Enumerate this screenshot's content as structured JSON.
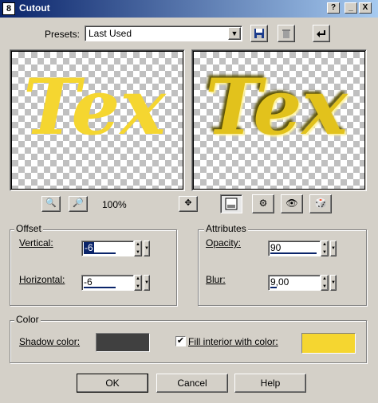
{
  "window": {
    "title": "Cutout",
    "icon_glyph": "8",
    "buttons": {
      "help": "?",
      "minimize": "_",
      "maximize": "□",
      "close": "X"
    }
  },
  "presets": {
    "label": "Presets:",
    "value": "Last Used",
    "icons": [
      "save-preset-icon",
      "delete-preset-icon",
      "reset-arrow-icon"
    ]
  },
  "preview": {
    "text": "Tex",
    "text_color": "#f5d630",
    "zoom": "100%"
  },
  "offset": {
    "title": "Offset",
    "vertical_label": "Vertical:",
    "vertical_value": "-6",
    "horizontal_label": "Horizontal:",
    "horizontal_value": "-6"
  },
  "attributes": {
    "title": "Attributes",
    "opacity_label": "Opacity:",
    "opacity_value": "90",
    "blur_label": "Blur:",
    "blur_value": "9,00"
  },
  "color": {
    "title": "Color",
    "shadow_label": "Shadow color:",
    "shadow_color": "#404040",
    "fill_label": "Fill interior with color:",
    "fill_checked": true,
    "fill_color": "#f5d630"
  },
  "footer": {
    "ok": "OK",
    "cancel": "Cancel",
    "help": "Help"
  }
}
